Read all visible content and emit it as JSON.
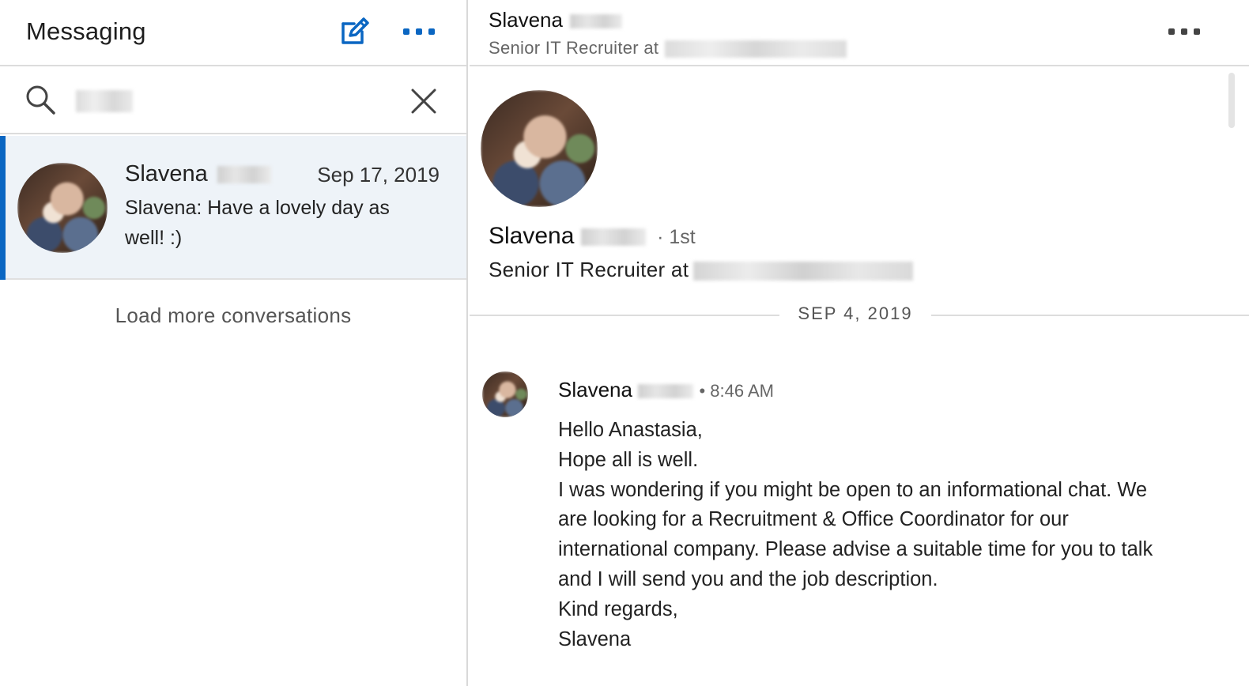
{
  "colors": {
    "accent": "#0a66c2",
    "selected_conversation_bg": "#eef3f8",
    "divider": "#dcdcdc"
  },
  "left": {
    "title": "Messaging",
    "compose_icon": "compose-icon",
    "more_icon": "more-horizontal-icon",
    "search": {
      "icon": "search-icon",
      "value": "",
      "clear_icon": "close-icon"
    },
    "conversations": [
      {
        "name": "Slavena",
        "date": "Sep 17, 2019",
        "preview": "Slavena: Have a lovely day as well! :)",
        "selected": true
      }
    ],
    "load_more": "Load more conversations"
  },
  "right": {
    "header": {
      "name": "Slavena",
      "subtitle": "Senior IT Recruiter at",
      "more_icon": "more-horizontal-icon"
    },
    "profile": {
      "name": "Slavena",
      "degree": "· 1st",
      "title": "Senior IT Recruiter at"
    },
    "date_divider": "SEP 4, 2019",
    "message": {
      "sender": "Slavena",
      "time": "• 8:46 AM",
      "lines": [
        "Hello Anastasia,",
        "Hope all is well.",
        "I was wondering if you might be open to an informational chat. We",
        "are looking for a Recruitment & Office Coordinator for our",
        "international company. Please advise a suitable time for you to talk",
        "and I will send you and the job description.",
        "Kind regards,",
        "Slavena"
      ]
    }
  }
}
